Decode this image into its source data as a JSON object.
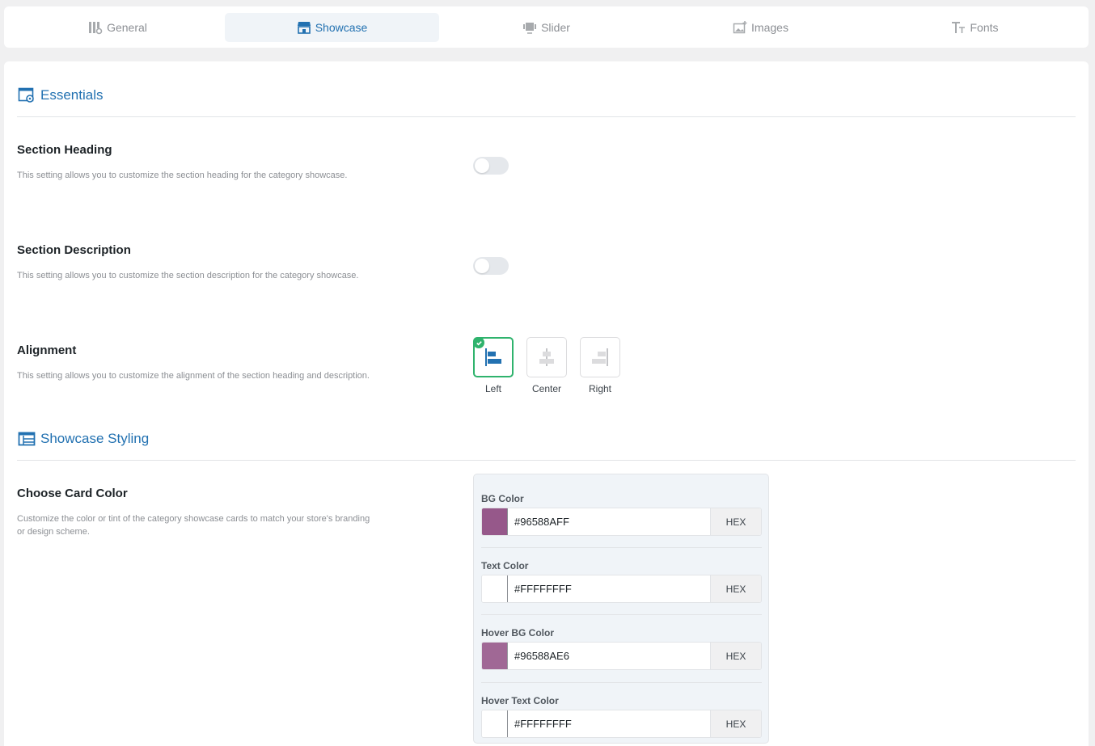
{
  "tabs": [
    {
      "label": "General",
      "icon": "general-settings-icon",
      "active": false
    },
    {
      "label": "Showcase",
      "icon": "store-icon",
      "active": true
    },
    {
      "label": "Slider",
      "icon": "slider-icon",
      "active": false
    },
    {
      "label": "Images",
      "icon": "image-icon",
      "active": false
    },
    {
      "label": "Fonts",
      "icon": "font-icon",
      "active": false
    }
  ],
  "essentials": {
    "title": "Essentials",
    "section_heading": {
      "label": "Section Heading",
      "description": "This setting allows you to customize the section heading for the category showcase.",
      "enabled": false
    },
    "section_description": {
      "label": "Section Description",
      "description": "This setting allows you to customize the section description for the category showcase.",
      "enabled": false
    },
    "alignment": {
      "label": "Alignment",
      "description": "This setting allows you to customize the alignment of the section heading and description.",
      "options": [
        "Left",
        "Center",
        "Right"
      ],
      "selected": "Left"
    }
  },
  "styling": {
    "title": "Showcase Styling",
    "card_color": {
      "label": "Choose Card Color",
      "description": "Customize the color or tint of the category showcase cards to match your store's branding or design scheme.",
      "fields": [
        {
          "label": "BG Color",
          "value": "#96588AFF",
          "swatch": "#96588a",
          "button": "HEX"
        },
        {
          "label": "Text Color",
          "value": "#FFFFFFFF",
          "swatch": "#ffffff",
          "button": "HEX"
        },
        {
          "label": "Hover BG Color",
          "value": "#96588AE6",
          "swatch": "#96588a",
          "button": "HEX"
        },
        {
          "label": "Hover Text Color",
          "value": "#FFFFFFFF",
          "swatch": "#ffffff",
          "button": "HEX"
        }
      ]
    }
  },
  "colors": {
    "accent": "#2271b1",
    "selected_border": "#2fb36d"
  }
}
